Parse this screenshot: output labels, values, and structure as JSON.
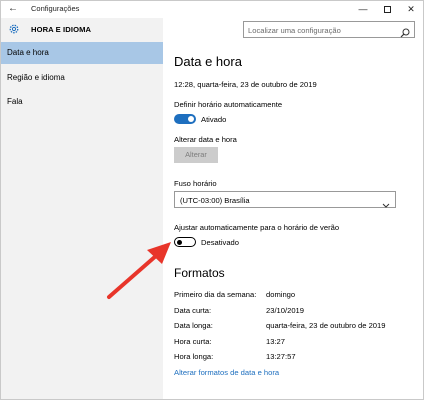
{
  "window": {
    "app_title": "Configurações",
    "back_glyph": "←",
    "minimize_glyph": "—",
    "close_glyph": "✕"
  },
  "sidebar": {
    "section_title": "HORA E IDIOMA",
    "items": [
      {
        "label": "Data e hora",
        "active": true
      },
      {
        "label": "Região e idioma",
        "active": false
      },
      {
        "label": "Fala",
        "active": false
      }
    ]
  },
  "search": {
    "placeholder": "Localizar uma configuração"
  },
  "main": {
    "title": "Data e hora",
    "current_datetime": "12:28, quarta-feira, 23 de outubro de 2019",
    "auto_time": {
      "label": "Definir horário automaticamente",
      "state": "Ativado",
      "on": true
    },
    "change_datetime": {
      "label": "Alterar data e hora",
      "button": "Alterar"
    },
    "timezone": {
      "label": "Fuso horário",
      "value": "(UTC-03:00) Brasília"
    },
    "dst": {
      "label": "Ajustar automaticamente para o horário de verão",
      "state": "Desativado",
      "on": false
    }
  },
  "formats": {
    "title": "Formatos",
    "rows": [
      {
        "key": "Primeiro dia da semana:",
        "value": "domingo"
      },
      {
        "key": "Data curta:",
        "value": "23/10/2019"
      },
      {
        "key": "Data longa:",
        "value": "quarta-feira, 23 de outubro de 2019"
      },
      {
        "key": "Hora curta:",
        "value": "13:27"
      },
      {
        "key": "Hora longa:",
        "value": "13:27:57"
      }
    ],
    "link": "Alterar formatos de data e hora"
  },
  "colors": {
    "accent": "#1e6fbf",
    "sidebar_bg": "#f2f2f2",
    "sidebar_active": "#a8c7e6",
    "arrow": "#e8352a"
  }
}
